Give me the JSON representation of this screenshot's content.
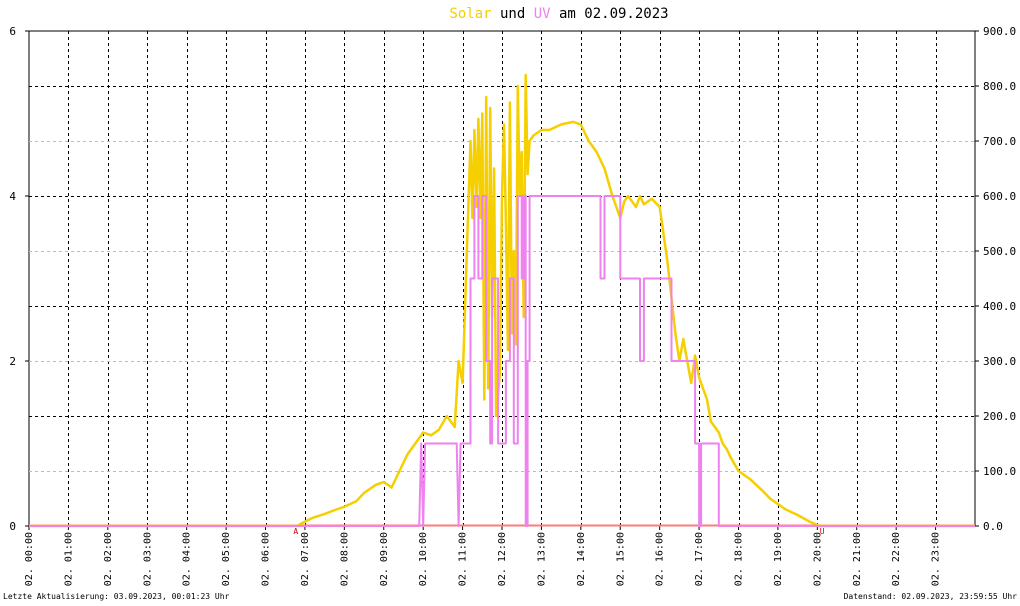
{
  "title": {
    "part1": "Solar",
    "part2": " und ",
    "part3": "UV",
    "part4": " am 02.09.2023"
  },
  "colors": {
    "solar": "#f5cf00",
    "uv": "#ee82ee",
    "baseline": "#ff7a7a",
    "grid": "#000000",
    "bg": "#ffffff"
  },
  "footer": {
    "left": "Letzte Aktualisierung: 03.09.2023, 00:01:23 Uhr",
    "right": "Datenstand: 02.09.2023, 23:59:55 Uhr"
  },
  "markers": {
    "sunrise": "A",
    "sunset": "U"
  },
  "chart_data": {
    "type": "line",
    "x_ticks": [
      "02. 00:00",
      "02. 01:00",
      "02. 02:00",
      "02. 03:00",
      "02. 04:00",
      "02. 05:00",
      "02. 06:00",
      "02. 07:00",
      "02. 08:00",
      "02. 09:00",
      "02. 10:00",
      "02. 11:00",
      "02. 12:00",
      "02. 13:00",
      "02. 14:00",
      "02. 15:00",
      "02. 16:00",
      "02. 17:00",
      "02. 18:00",
      "02. 19:00",
      "02. 20:00",
      "02. 21:00",
      "02. 22:00",
      "02. 23:00"
    ],
    "xlim": [
      0,
      24
    ],
    "y_left": {
      "ticks": [
        "0",
        "2",
        "4",
        "6"
      ],
      "ylim": [
        0,
        6
      ]
    },
    "y_right": {
      "ticks": [
        "0.0",
        "100.0",
        "200.0",
        "300.0",
        "400.0",
        "500.0",
        "600.0",
        "700.0",
        "800.0",
        "900.0"
      ],
      "ylim": [
        0,
        900
      ]
    },
    "marker_positions": {
      "A": 6.77,
      "U": 20.02
    },
    "series": [
      {
        "name": "Solar",
        "axis": "right",
        "x": [
          0,
          6.7,
          6.8,
          7.0,
          7.2,
          7.5,
          7.8,
          8.0,
          8.3,
          8.5,
          8.8,
          9.0,
          9.2,
          9.4,
          9.6,
          9.8,
          10.0,
          10.2,
          10.4,
          10.6,
          10.8,
          10.9,
          11.0,
          11.1,
          11.2,
          11.25,
          11.3,
          11.35,
          11.4,
          11.45,
          11.5,
          11.55,
          11.6,
          11.65,
          11.7,
          11.75,
          11.8,
          11.85,
          11.9,
          11.95,
          12.0,
          12.05,
          12.1,
          12.15,
          12.2,
          12.25,
          12.3,
          12.35,
          12.4,
          12.45,
          12.5,
          12.55,
          12.6,
          12.65,
          12.7,
          12.8,
          13.0,
          13.2,
          13.5,
          13.8,
          14.0,
          14.2,
          14.4,
          14.6,
          14.8,
          15.0,
          15.1,
          15.2,
          15.4,
          15.5,
          15.6,
          15.8,
          16.0,
          16.2,
          16.4,
          16.5,
          16.6,
          16.8,
          16.9,
          17.0,
          17.1,
          17.2,
          17.3,
          17.5,
          17.6,
          17.7,
          17.8,
          18.0,
          18.3,
          18.6,
          18.8,
          19.0,
          19.2,
          19.5,
          19.8,
          20.0,
          20.02,
          24.0
        ],
        "values": [
          0,
          0,
          0,
          8,
          15,
          22,
          30,
          35,
          45,
          60,
          75,
          80,
          70,
          100,
          130,
          150,
          170,
          165,
          175,
          200,
          180,
          300,
          260,
          480,
          700,
          560,
          720,
          580,
          740,
          560,
          750,
          230,
          780,
          250,
          760,
          380,
          650,
          200,
          240,
          280,
          600,
          730,
          550,
          320,
          770,
          350,
          500,
          330,
          800,
          600,
          680,
          380,
          820,
          640,
          700,
          710,
          720,
          720,
          730,
          735,
          730,
          700,
          680,
          650,
          600,
          560,
          590,
          600,
          580,
          600,
          585,
          595,
          580,
          480,
          350,
          300,
          340,
          260,
          310,
          270,
          250,
          230,
          190,
          170,
          150,
          140,
          125,
          100,
          85,
          65,
          50,
          40,
          30,
          20,
          8,
          2,
          0,
          0
        ]
      },
      {
        "name": "UV",
        "axis": "left",
        "x": [
          0,
          9.9,
          9.95,
          10.0,
          10.05,
          10.85,
          10.9,
          10.95,
          11.0,
          11.2,
          11.2,
          11.3,
          11.3,
          11.4,
          11.4,
          11.5,
          11.5,
          11.6,
          11.6,
          11.7,
          11.7,
          11.75,
          11.75,
          11.9,
          11.9,
          12.1,
          12.1,
          12.2,
          12.2,
          12.3,
          12.3,
          12.4,
          12.4,
          12.5,
          12.5,
          12.55,
          12.55,
          12.6,
          12.6,
          12.65,
          12.65,
          12.7,
          12.7,
          13.0,
          14.5,
          14.5,
          14.6,
          14.6,
          15.0,
          15.0,
          15.1,
          15.1,
          15.5,
          15.5,
          15.6,
          15.6,
          16.3,
          16.3,
          16.9,
          16.9,
          17.0,
          17.0,
          17.05,
          17.05,
          17.3,
          17.3,
          17.5,
          17.5,
          17.7,
          17.7,
          20.0,
          24.0
        ],
        "values": [
          0,
          0,
          1,
          0,
          1,
          1,
          0,
          1,
          1,
          1,
          3,
          3,
          4,
          4,
          3,
          3,
          4,
          4,
          2,
          2,
          1,
          1,
          3,
          3,
          1,
          1,
          2,
          2,
          3,
          3,
          1,
          1,
          4,
          4,
          3,
          3,
          4,
          4,
          0,
          0,
          2,
          2,
          4,
          4,
          4,
          3,
          3,
          4,
          4,
          3,
          3,
          3,
          3,
          2,
          2,
          3,
          3,
          2,
          2,
          1,
          1,
          0,
          0,
          1,
          1,
          1,
          1,
          0,
          0,
          0,
          0,
          0
        ]
      }
    ],
    "grid": true
  }
}
